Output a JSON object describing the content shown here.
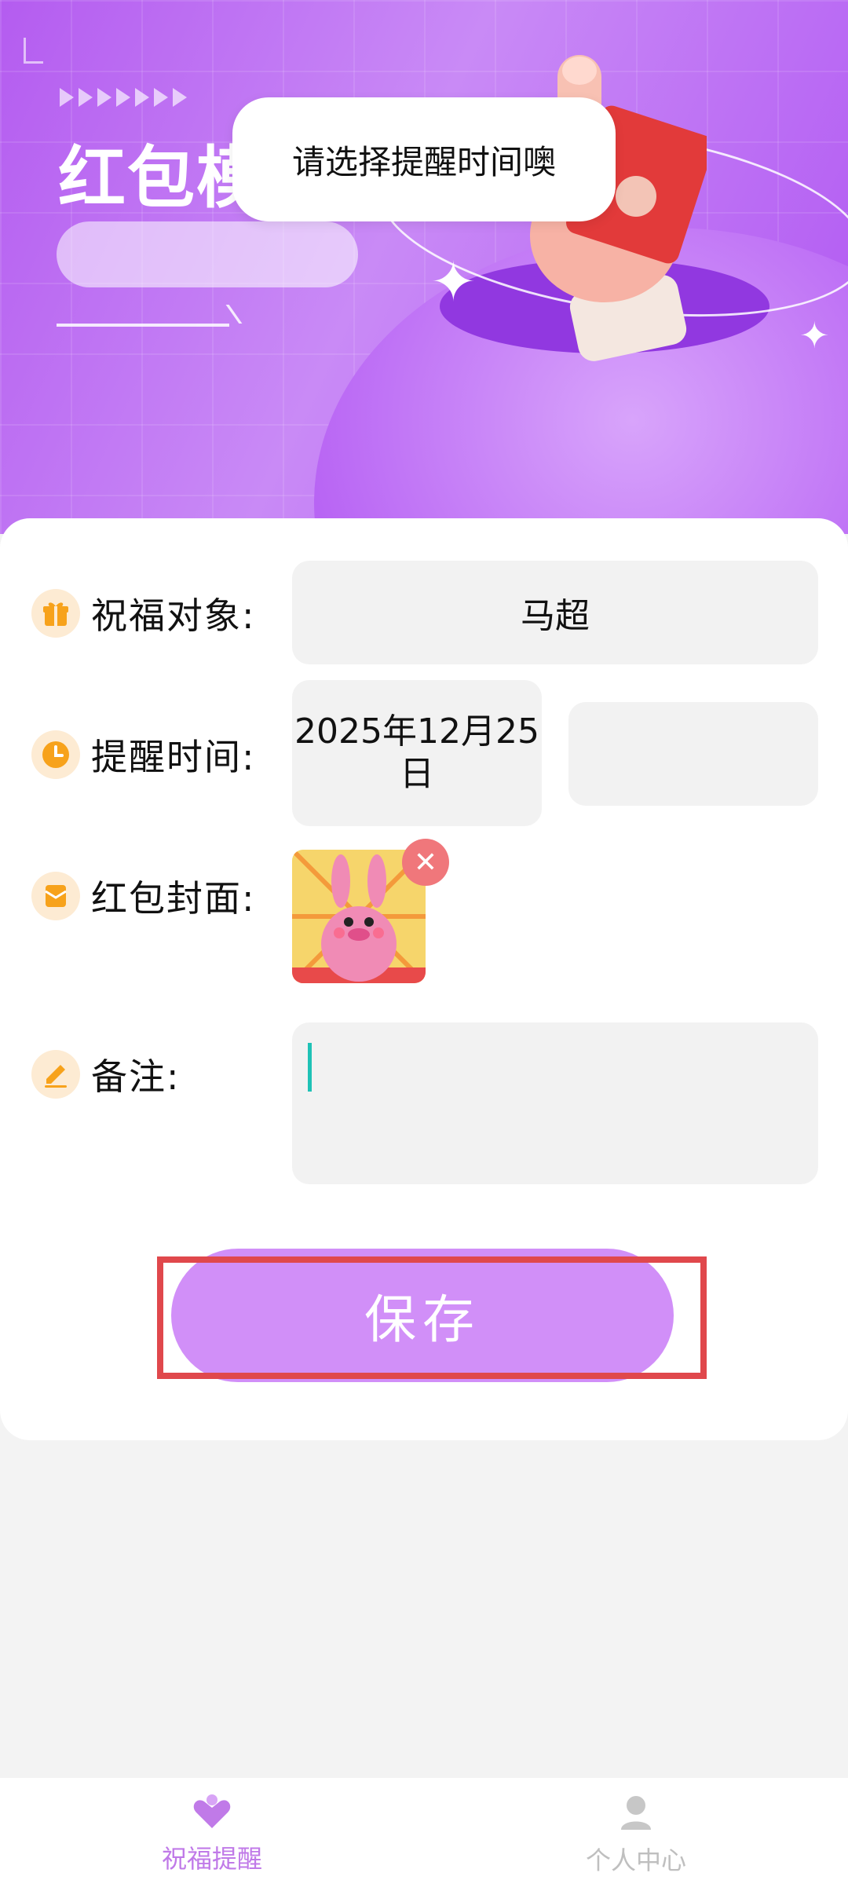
{
  "hero": {
    "title": "红包模",
    "toast": "请选择提醒时间噢"
  },
  "form": {
    "recipient": {
      "label": "祝福对象:",
      "value": "马超"
    },
    "reminder_time": {
      "label": "提醒时间:",
      "date_value": "2025年12月25日",
      "time_value": ""
    },
    "cover": {
      "label": "红包封面:"
    },
    "note": {
      "label": "备注:",
      "value": ""
    }
  },
  "actions": {
    "save_label": "保存"
  },
  "bottom_nav": {
    "items": [
      {
        "label": "祝福提醒",
        "icon": "hearts-icon",
        "active": true
      },
      {
        "label": "个人中心",
        "icon": "person-icon",
        "active": false
      }
    ]
  },
  "colors": {
    "hero_purple": "#b45cf0",
    "save_button": "#d18ff8",
    "icon_orange": "#f7a21b",
    "active_nav": "#c07ae8",
    "highlight_red": "#e0484c"
  }
}
